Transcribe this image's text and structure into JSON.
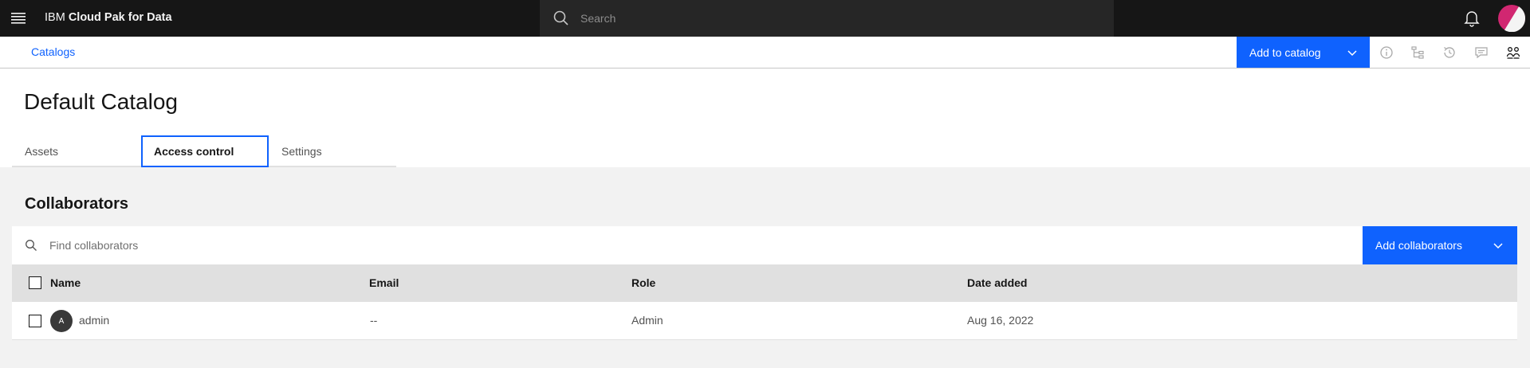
{
  "app": {
    "brand_prefix": "IBM",
    "brand_name": "Cloud Pak for Data"
  },
  "topbar": {
    "search_placeholder": "Search"
  },
  "breadcrumb": {
    "label": "Catalogs"
  },
  "actions": {
    "add_to_catalog": "Add to catalog"
  },
  "page": {
    "title": "Default Catalog"
  },
  "tabs": [
    {
      "label": "Assets",
      "selected": false
    },
    {
      "label": "Access control",
      "selected": true
    },
    {
      "label": "Settings",
      "selected": false
    }
  ],
  "collaborators": {
    "title": "Collaborators",
    "search_placeholder": "Find collaborators",
    "add_button": "Add collaborators",
    "columns": [
      "Name",
      "Email",
      "Role",
      "Date added"
    ],
    "rows": [
      {
        "initial": "A",
        "name": "admin",
        "email": "--",
        "role": "Admin",
        "date_added": "Aug 16, 2022"
      }
    ]
  },
  "colors": {
    "accent": "#0f62fe",
    "topbar": "#161616",
    "avatar_brand": "#d12771"
  }
}
